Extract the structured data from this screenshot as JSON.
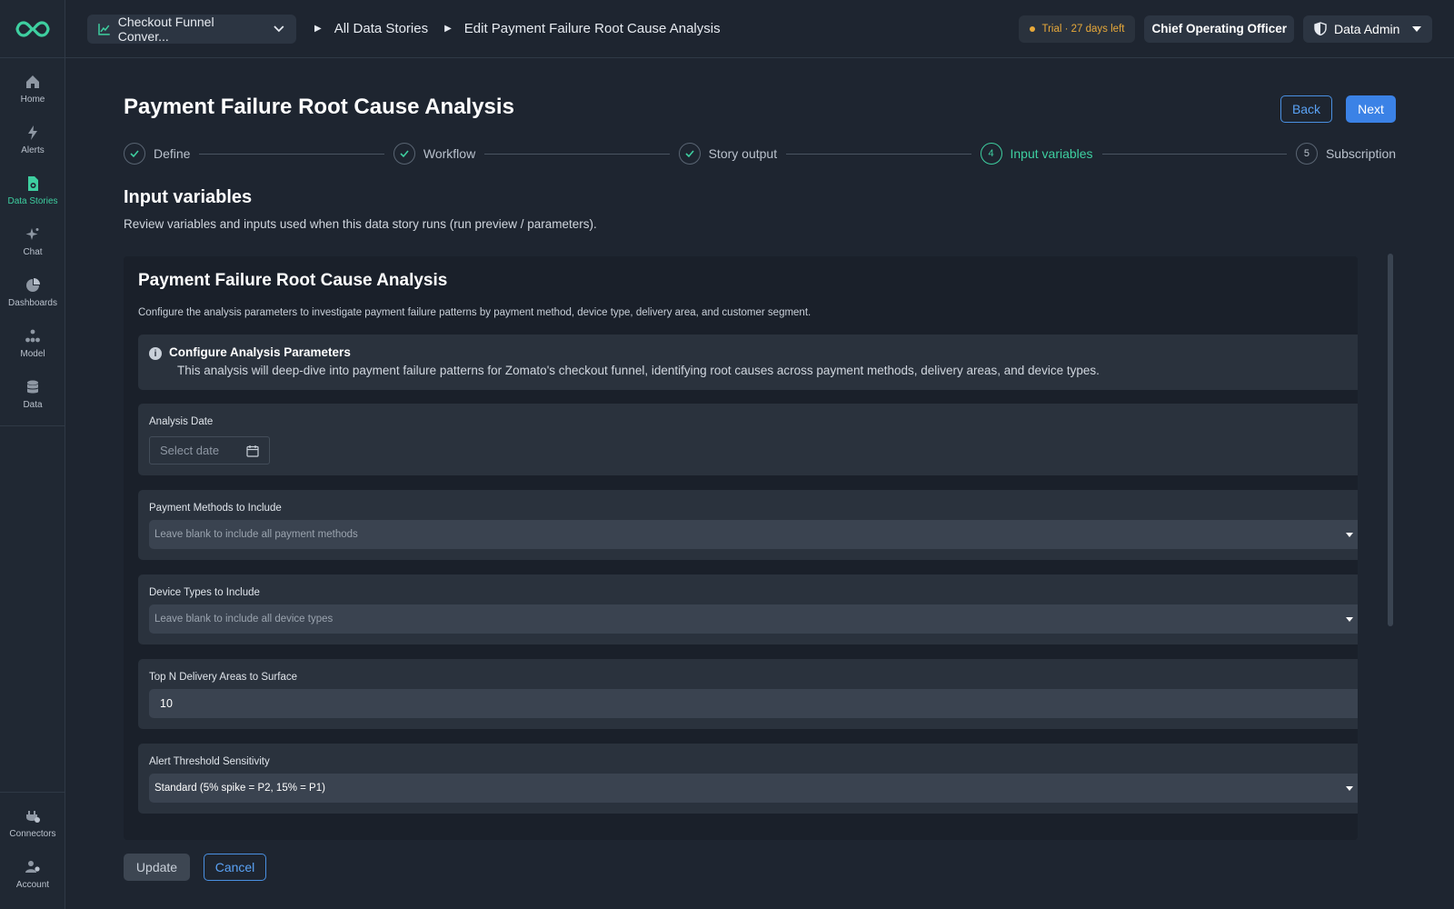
{
  "sidebar": {
    "items": [
      {
        "label": "Home",
        "icon": "home-icon"
      },
      {
        "label": "Alerts",
        "icon": "bolt-icon"
      },
      {
        "label": "Data Stories",
        "icon": "document-icon",
        "active": true
      },
      {
        "label": "Chat",
        "icon": "sparkle-icon"
      },
      {
        "label": "Dashboards",
        "icon": "pie-chart-icon"
      },
      {
        "label": "Model",
        "icon": "model-icon"
      },
      {
        "label": "Data",
        "icon": "database-icon"
      }
    ],
    "bottom_items": [
      {
        "label": "Connectors",
        "icon": "plug-icon"
      },
      {
        "label": "Account",
        "icon": "account-icon"
      }
    ]
  },
  "header": {
    "story_select": "Checkout Funnel Conver...",
    "breadcrumbs": [
      "All Data Stories",
      "Edit Payment Failure Root Cause Analysis"
    ],
    "trial": "Trial · 27 days left",
    "role": "Chief Operating Officer",
    "admin": "Data Admin"
  },
  "page": {
    "title": "Payment Failure Root Cause Analysis",
    "back_label": "Back",
    "next_label": "Next"
  },
  "stepper": {
    "steps": [
      {
        "label": "Define",
        "state": "done"
      },
      {
        "label": "Workflow",
        "state": "done"
      },
      {
        "label": "Story output",
        "state": "done"
      },
      {
        "label": "Input variables",
        "state": "current",
        "number": "4"
      },
      {
        "label": "Subscription",
        "state": "todo",
        "number": "5"
      }
    ]
  },
  "section": {
    "title": "Input variables",
    "description": "Review variables and inputs used when this data story runs (run preview / parameters)."
  },
  "form": {
    "title": "Payment Failure Root Cause Analysis",
    "description": "Configure the analysis parameters to investigate payment failure patterns by payment method, device type, delivery area, and customer segment.",
    "info_title": "Configure Analysis Parameters",
    "info_text": "This analysis will deep-dive into payment failure patterns for Zomato's checkout funnel, identifying root causes across payment methods, delivery areas, and device types.",
    "analysis_date": {
      "label": "Analysis Date",
      "placeholder": "Select date"
    },
    "payment_methods": {
      "label": "Payment Methods to Include",
      "placeholder": "Leave blank to include all payment methods"
    },
    "device_types": {
      "label": "Device Types to Include",
      "placeholder": "Leave blank to include all device types"
    },
    "top_n": {
      "label": "Top N Delivery Areas to Surface",
      "value": "10"
    },
    "alert_threshold": {
      "label": "Alert Threshold Sensitivity",
      "value": "Standard (5% spike = P2, 15% = P1)"
    }
  },
  "footer": {
    "update_label": "Update",
    "cancel_label": "Cancel"
  },
  "colors": {
    "accent_green": "#3ecfa0",
    "accent_blue": "#3b82e6",
    "trial_orange": "#e8a93a",
    "background": "#1e2530"
  }
}
